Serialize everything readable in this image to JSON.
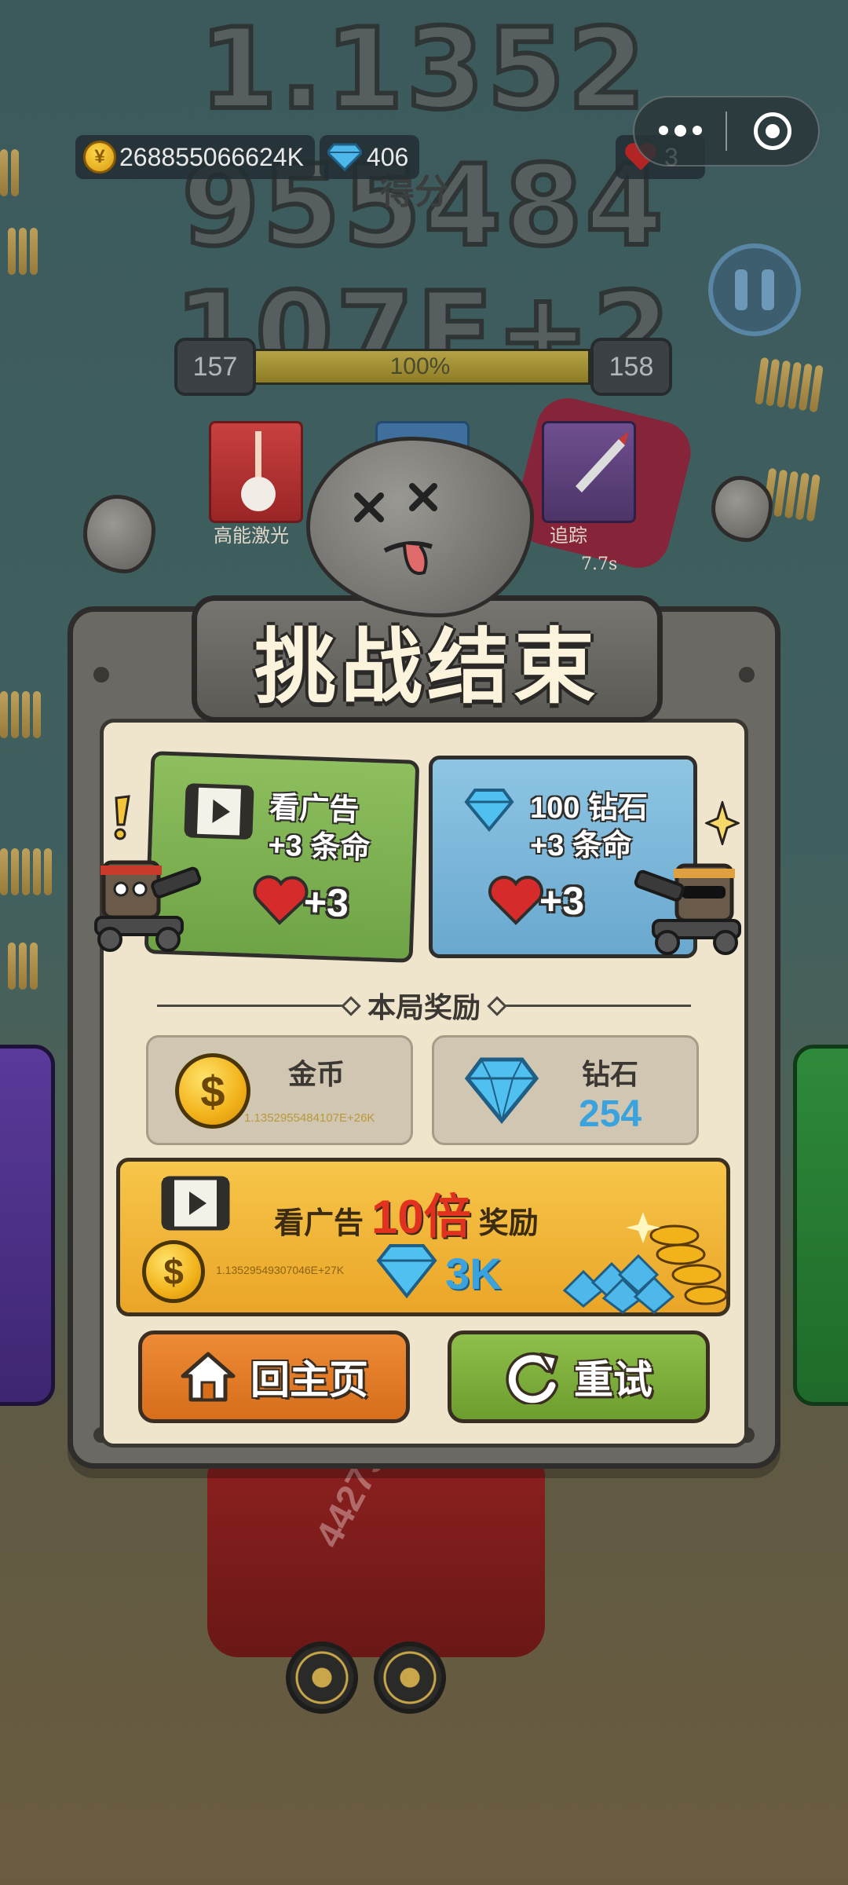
{
  "hud": {
    "score_line1": "1.1352",
    "score_line2": "955484",
    "score_line3": "107E+2",
    "score_label": "得分",
    "coins": "268855066624K",
    "gems": "406",
    "lives": "3"
  },
  "level": {
    "current": "157",
    "next": "158",
    "progress_label": "100%",
    "progress": 1.0
  },
  "skills": [
    {
      "label": "高能激光",
      "icon": "laser-icon"
    },
    {
      "label": "追踪",
      "icon": "missile-icon",
      "timer": "7.7s"
    }
  ],
  "tank_hp": "44279",
  "modal": {
    "title": "挑战结束",
    "revive_ad": {
      "line1": "看广告",
      "line2": "+3 条命",
      "reward": "+3"
    },
    "revive_gem": {
      "line1": "100 钻石",
      "line2": "+3 条命",
      "reward": "+3"
    },
    "section_title": "本局奖励",
    "coin_reward": {
      "label": "金币",
      "value": "1.1352955484107E+26K"
    },
    "gem_reward": {
      "label": "钻石",
      "value": "254"
    },
    "ad_bonus": {
      "prefix": "看广告",
      "multiplier": "10倍",
      "suffix": "奖励",
      "coin_value": "1.13529549307046E+27K",
      "gem_value": "3K"
    },
    "home_button": "回主页",
    "retry_button": "重试"
  },
  "colors": {
    "green_card": "#7bb150",
    "blue_card": "#78b4d8",
    "gold_banner": "#f2b83a",
    "home_button": "#e27d28",
    "retry_button": "#7aad3a",
    "gem_text": "#3aa3dd"
  }
}
